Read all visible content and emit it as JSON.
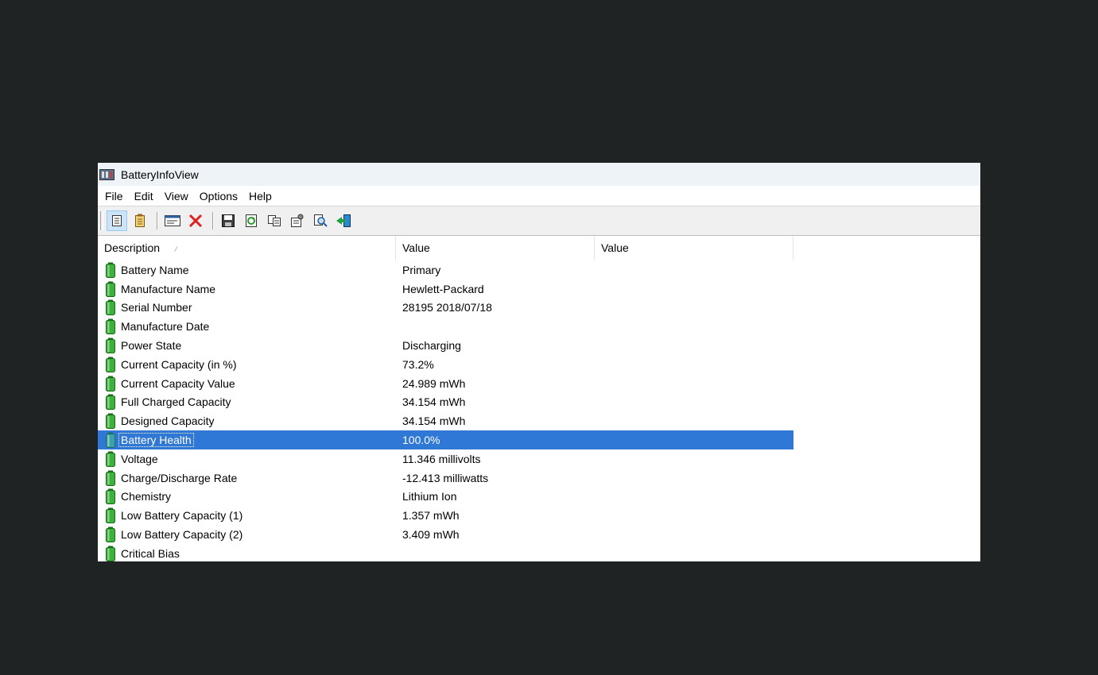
{
  "window": {
    "title": "BatteryInfoView"
  },
  "menu": [
    "File",
    "Edit",
    "View",
    "Options",
    "Help"
  ],
  "toolbar": {
    "buttons": [
      "properties-icon",
      "notes-icon",
      "html-report-icon",
      "delete-icon",
      "save-icon",
      "refresh-icon",
      "copy-icon",
      "options-icon",
      "find-icon",
      "exit-icon"
    ]
  },
  "columns": [
    "Description",
    "Value",
    "Value"
  ],
  "sort_indicator": "⁄",
  "rows": [
    {
      "label": "Battery Name",
      "value": "Primary",
      "value2": ""
    },
    {
      "label": "Manufacture Name",
      "value": "Hewlett-Packard",
      "value2": ""
    },
    {
      "label": "Serial Number",
      "value": "28195 2018/07/18",
      "value2": ""
    },
    {
      "label": "Manufacture Date",
      "value": "",
      "value2": ""
    },
    {
      "label": "Power State",
      "value": "Discharging",
      "value2": ""
    },
    {
      "label": "Current Capacity (in %)",
      "value": "73.2%",
      "value2": ""
    },
    {
      "label": "Current Capacity Value",
      "value": "24.989 mWh",
      "value2": ""
    },
    {
      "label": "Full Charged Capacity",
      "value": "34.154 mWh",
      "value2": ""
    },
    {
      "label": "Designed Capacity",
      "value": "34.154 mWh",
      "value2": ""
    },
    {
      "label": "Battery Health",
      "value": "100.0%",
      "value2": "",
      "selected": true
    },
    {
      "label": "Voltage",
      "value": "11.346 millivolts",
      "value2": ""
    },
    {
      "label": "Charge/Discharge Rate",
      "value": "-12.413 milliwatts",
      "value2": ""
    },
    {
      "label": "Chemistry",
      "value": "Lithium Ion",
      "value2": ""
    },
    {
      "label": "Low Battery Capacity (1)",
      "value": "1.357 mWh",
      "value2": ""
    },
    {
      "label": "Low Battery Capacity (2)",
      "value": "3.409 mWh",
      "value2": ""
    },
    {
      "label": "Critical Bias",
      "value": "",
      "value2": ""
    }
  ],
  "colors": {
    "background": "#202324",
    "selection": "#3078d6",
    "battery_green": "#2e9d2e"
  }
}
